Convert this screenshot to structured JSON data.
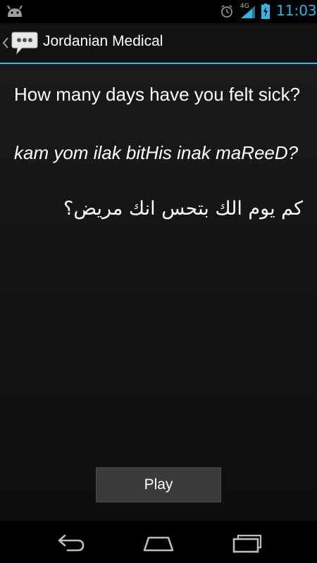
{
  "status_bar": {
    "network_type": "4G",
    "time": "11:03",
    "icons": [
      "android-debug-icon",
      "alarm-icon",
      "signal-icon",
      "battery-charging-icon"
    ]
  },
  "action_bar": {
    "title": "Jordanian Medical",
    "icons": [
      "up-caret-icon",
      "speech-bubble-app-icon"
    ]
  },
  "phrase": {
    "english": "How many days have you felt sick?",
    "transliteration": "kam yom ilak bitHis inak maReeD?",
    "arabic": "كم يوم الك بتحس انك مريض؟"
  },
  "controls": {
    "play_label": "Play"
  },
  "nav_bar": {
    "icons": [
      "back-icon",
      "home-icon",
      "recents-icon"
    ]
  },
  "colors": {
    "accent": "#33b5e5",
    "background": "#141517",
    "button": "#3a3b3d"
  }
}
